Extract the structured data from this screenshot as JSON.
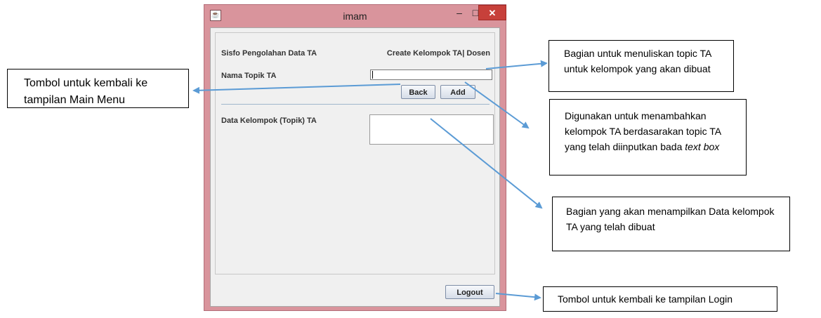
{
  "window": {
    "title": "imam",
    "minimize_glyph": "–",
    "maximize_glyph": "□",
    "close_glyph": "✕",
    "app_icon": "java-app-icon"
  },
  "form": {
    "app_label": "Sisfo Pengolahan Data TA",
    "page_label": "Create Kelompok TA| Dosen",
    "topic_label": "Nama Topik TA",
    "topic_value": "",
    "back_label": "Back",
    "add_label": "Add",
    "data_label": "Data Kelompok (Topik) TA",
    "logout_label": "Logout"
  },
  "annotations": {
    "back_note": "Tombol untuk kembali ke tampilan Main Menu",
    "topic_note": "Bagian untuk menuliskan topic TA untuk kelompok yang akan dibuat",
    "add_note_prefix": "Digunakan untuk menambahkan kelompok TA berdasarakan topic TA yang telah diinputkan bada ",
    "add_note_italic": "text box",
    "data_note": "Bagian yang akan menampilkan Data kelompok TA yang telah dibuat",
    "logout_note": "Tombol untuk kembali ke tampilan Login"
  },
  "colors": {
    "arrow": "#5b9bd5",
    "window_frame": "#d9949c",
    "close_button": "#c7403a"
  }
}
